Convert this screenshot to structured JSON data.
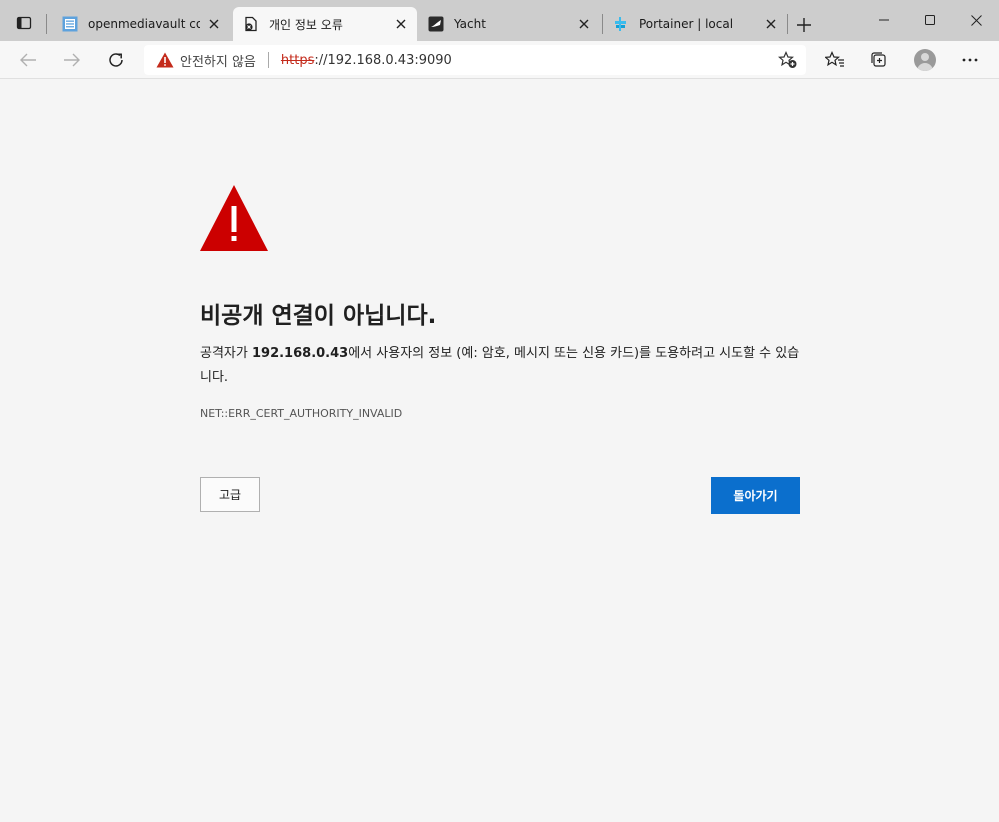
{
  "tabs": [
    {
      "title": "openmediavault contr",
      "favicon": "openmediavault-icon",
      "active": false
    },
    {
      "title": "개인 정보 오류",
      "favicon": "certificate-error-icon",
      "active": true
    },
    {
      "title": "Yacht",
      "favicon": "yacht-icon",
      "active": false
    },
    {
      "title": "Portainer | local",
      "favicon": "portainer-icon",
      "active": false
    }
  ],
  "addressbar": {
    "security_label": "안전하지 않음",
    "url_scheme": "https",
    "url_rest": "://192.168.0.43:9090"
  },
  "page": {
    "heading": "비공개 연결이 아닙니다.",
    "desc_before": "공격자가 ",
    "desc_host": "192.168.0.43",
    "desc_after": "에서 사용자의 정보 (예: 암호, 메시지 또는 신용 카드)를 도용하려고 시도할 수 있습니다.",
    "error_code": "NET::ERR_CERT_AUTHORITY_INVALID",
    "advanced_label": "고급",
    "back_label": "돌아가기"
  },
  "colors": {
    "accent": "#0b6fcd",
    "warning": "#cc0000"
  }
}
